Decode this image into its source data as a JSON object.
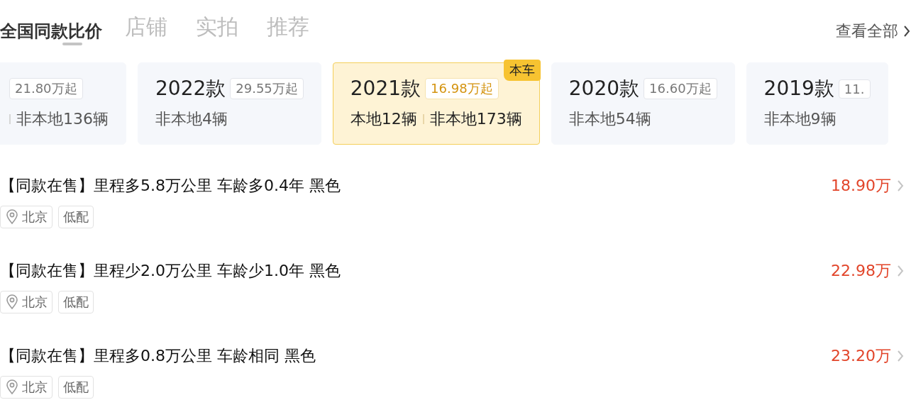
{
  "tabs": [
    {
      "label": "店铺"
    },
    {
      "label": "实拍"
    },
    {
      "label": "推荐"
    }
  ],
  "section": {
    "title": "全国同款比价",
    "view_all": "查看全部"
  },
  "cards": [
    {
      "price": "21.80万起",
      "nonlocal": "非本地136辆",
      "clipped_left": true,
      "selected": false
    },
    {
      "year": "2022款",
      "price": "29.55万起",
      "nonlocal": "非本地4辆",
      "selected": false
    },
    {
      "year": "2021款",
      "price": "16.98万起",
      "local": "本地12辆",
      "nonlocal": "非本地173辆",
      "badge": "本车",
      "selected": true
    },
    {
      "year": "2020款",
      "price": "16.60万起",
      "nonlocal": "非本地54辆",
      "selected": false
    },
    {
      "year": "2019款",
      "price": "11.",
      "nonlocal": "非本地9辆",
      "selected": false
    }
  ],
  "listings": [
    {
      "title": "【同款在售】里程多5.8万公里 车龄多0.4年 黑色",
      "price": "18.90万",
      "tags": [
        {
          "label": "北京",
          "kind": "location"
        },
        {
          "label": "低配",
          "kind": "plain"
        }
      ]
    },
    {
      "title": "【同款在售】里程少2.0万公里 车龄少1.0年 黑色",
      "price": "22.98万",
      "tags": [
        {
          "label": "北京",
          "kind": "location"
        },
        {
          "label": "低配",
          "kind": "plain"
        }
      ]
    },
    {
      "title": "【同款在售】里程多0.8万公里 车龄相同 黑色",
      "price": "23.20万",
      "tags": [
        {
          "label": "北京",
          "kind": "location"
        },
        {
          "label": "低配",
          "kind": "plain"
        }
      ]
    }
  ]
}
